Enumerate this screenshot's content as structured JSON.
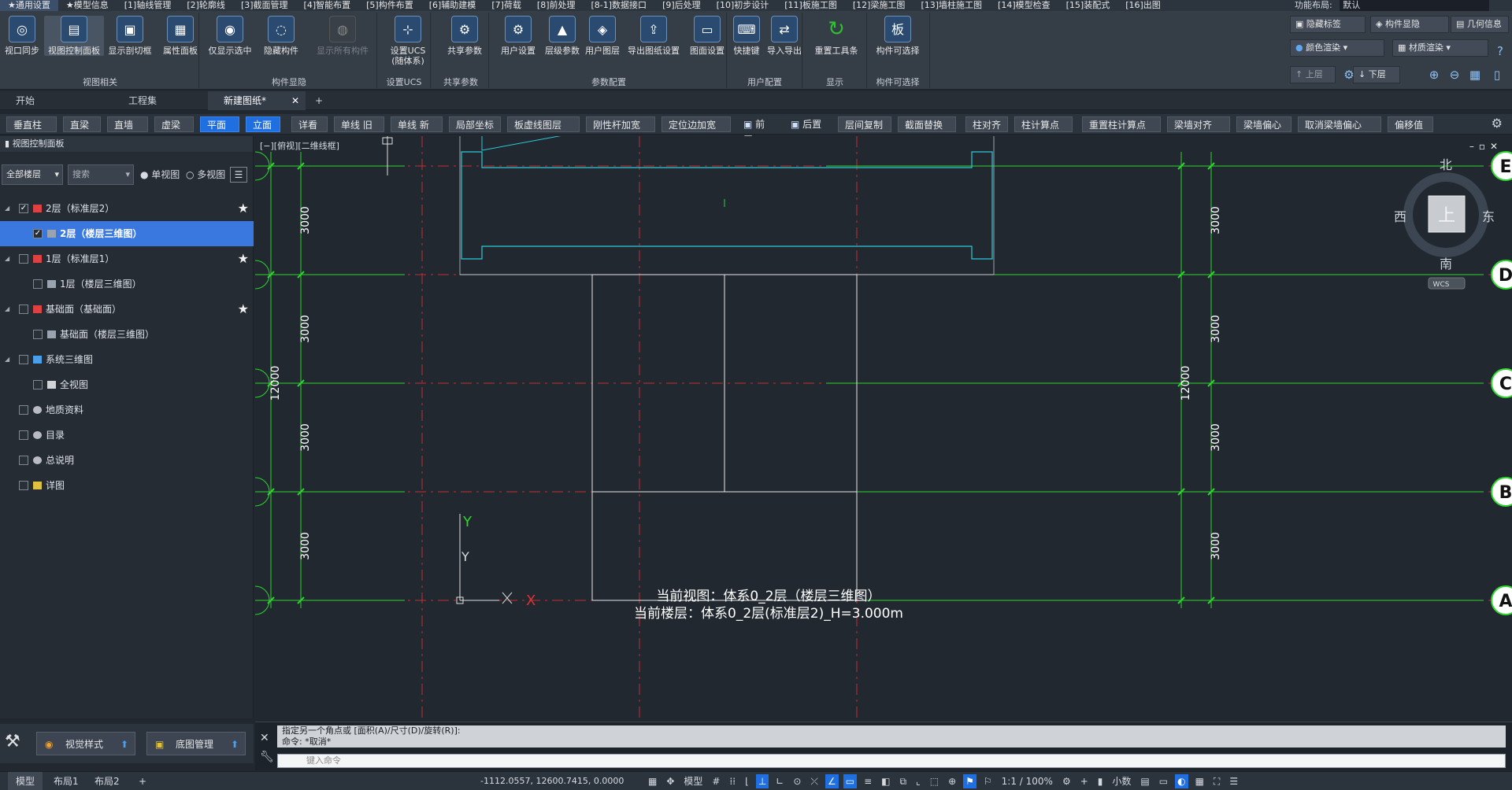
{
  "menu_tabs": [
    "★通用设置",
    "★模型信息",
    "[1]轴线管理",
    "[2]轮廓线",
    "[3]截面管理",
    "[4]智能布置",
    "[5]构件布置",
    "[6]辅助建模",
    "[7]荷载",
    "[8]前处理",
    "[8-1]数据接口",
    "[9]后处理",
    "[10]初步设计",
    "[11]板施工图",
    "[12]梁施工图",
    "[13]墙柱施工图",
    "[14]模型检查",
    "[15]装配式",
    "[16]出图"
  ],
  "layout": {
    "label": "功能布局:",
    "value": "默认"
  },
  "ribbon": {
    "buttons": [
      {
        "label": "视口同步",
        "icon": "sync-viewport-icon",
        "glyph": "◎"
      },
      {
        "label": "视图控制面板",
        "icon": "view-panel-icon",
        "glyph": "▤"
      },
      {
        "label": "显示剖切框",
        "icon": "section-box-icon",
        "glyph": "▣"
      },
      {
        "label": "属性面板",
        "icon": "property-panel-icon",
        "glyph": "▦"
      },
      {
        "label": "仅显示选中",
        "icon": "eye-icon",
        "glyph": "◉"
      },
      {
        "label": "隐藏构件",
        "icon": "hide-eye-icon",
        "glyph": "◌"
      },
      {
        "label": "显示所有构件",
        "icon": "show-all-icon",
        "glyph": "◍"
      },
      {
        "label": "设置UCS",
        "label2": "(随体系)",
        "icon": "ucs-icon",
        "glyph": "⊹"
      },
      {
        "label": "共享参数",
        "icon": "share-param-icon",
        "glyph": "⚙"
      },
      {
        "label": "用户设置",
        "icon": "user-settings-icon",
        "glyph": "⚙"
      },
      {
        "label": "层级参数",
        "icon": "level-param-icon",
        "glyph": "▲"
      },
      {
        "label": "用户图层",
        "icon": "user-layer-icon",
        "glyph": "◈"
      },
      {
        "label": "导出图纸设置",
        "icon": "export-drawing-icon",
        "glyph": "⇪"
      },
      {
        "label": "图面设置",
        "icon": "drawing-settings-icon",
        "glyph": "▭"
      },
      {
        "label": "快捷键",
        "icon": "keyboard-icon",
        "glyph": "⌨"
      },
      {
        "label": "导入导出",
        "icon": "import-export-icon",
        "glyph": "⇄"
      },
      {
        "label": "重置工具条",
        "icon": "reset-toolbar-icon",
        "glyph": "↻"
      },
      {
        "label": "构件可选择",
        "icon": "selectable-icon",
        "glyph": "板"
      }
    ],
    "groups": [
      "视图相关",
      "构件显隐",
      "设置UCS",
      "共享参数",
      "参数配置",
      "用户配置",
      "显示",
      "构件可选择"
    ],
    "side": [
      "隐藏标签",
      "构件显隐",
      "几何信息",
      "颜色渲染",
      "材质渲染",
      "上层",
      "下层"
    ]
  },
  "doc_tabs": [
    "开始",
    "工程集",
    "新建图纸*"
  ],
  "toolbar": [
    "垂直柱",
    "直梁",
    "直墙",
    "虚梁",
    "平面",
    "立面",
    "详看",
    "单线 旧",
    "单线 新",
    "局部坐标",
    "板虚线图层",
    "刚性杆加宽",
    "定位边加宽",
    "前置",
    "后置",
    "层间复制",
    "截面替换",
    "柱对齐",
    "柱计算点",
    "重置柱计算点",
    "梁墙对齐",
    "梁墙偏心",
    "取消梁墙偏心",
    "偏移值"
  ],
  "panel": {
    "title": "视图控制面板",
    "floor_select": "全部楼层",
    "search_placeholder": "搜索",
    "single_view": "单视图",
    "multi_view": "多视图",
    "tree": [
      {
        "label": "2层（标准层2）",
        "level": 0,
        "star": true
      },
      {
        "label": "2层（楼层三维图）",
        "level": 1,
        "selected": true
      },
      {
        "label": "1层（标准层1）",
        "level": 0,
        "star": true
      },
      {
        "label": "1层（楼层三维图）",
        "level": 1
      },
      {
        "label": "基础面（基础面）",
        "level": 0,
        "star": true
      },
      {
        "label": "基础面（楼层三维图）",
        "level": 1
      },
      {
        "label": "系统三维图",
        "level": 0
      },
      {
        "label": "全视图",
        "level": 1
      },
      {
        "label": "地质资料",
        "level": 0
      },
      {
        "label": "目录",
        "level": 0
      },
      {
        "label": "总说明",
        "level": 0
      },
      {
        "label": "详图",
        "level": 0
      }
    ],
    "bottom": [
      "视觉样式",
      "底图管理"
    ]
  },
  "viewport": {
    "label": "[−][俯视][二维线框]",
    "axes": [
      "E",
      "D",
      "C",
      "B",
      "A"
    ],
    "dims": [
      "3000",
      "3000",
      "3000",
      "3000"
    ],
    "total": "12000",
    "compass": {
      "n": "北",
      "s": "南",
      "e": "东",
      "w": "西",
      "top": "上",
      "wcs": "WCS"
    },
    "ucs_x": "X",
    "ucs_y": "Y",
    "info1": "当前视图：体系0_2层（楼层三维图）",
    "info2": "当前楼层：体系0_2层(标准层2)_H=3.000m"
  },
  "command": {
    "line1": "指定另一个角点或 [面积(A)/尺寸(D)/旋转(R)]:",
    "line2": "命令: *取消*",
    "placeholder": "键入命令"
  },
  "status": {
    "tabs": [
      "模型",
      "布局1",
      "布局2"
    ],
    "coords": "-1112.0557, 12600.7415, 0.0000",
    "mode": "模型",
    "scale": "1:1 / 100%",
    "units": "小数"
  }
}
